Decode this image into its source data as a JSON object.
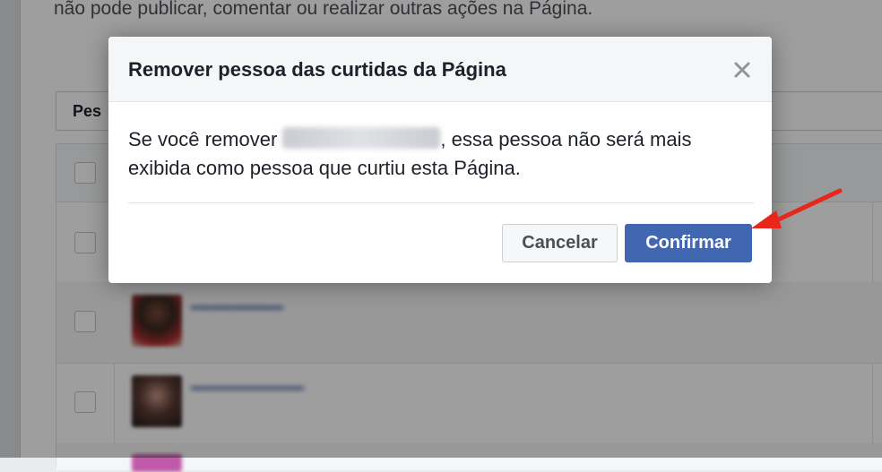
{
  "background_page": {
    "intro_text": "não pode publicar, comentar ou realizar outras ações na Página.",
    "search_placeholder": "Pes"
  },
  "dialog": {
    "title": "Remover pessoa das curtidas da Página",
    "body_before": "Se você remover ",
    "body_after": ", essa pessoa não será mais exibida como pessoa que curtiu esta Página.",
    "cancel_label": "Cancelar",
    "confirm_label": "Confirmar"
  },
  "colors": {
    "confirm_button": "#4267b2",
    "annotation_arrow": "#e8261c"
  },
  "icons": {
    "close": "close-icon",
    "annotation": "red-arrow-icon"
  }
}
